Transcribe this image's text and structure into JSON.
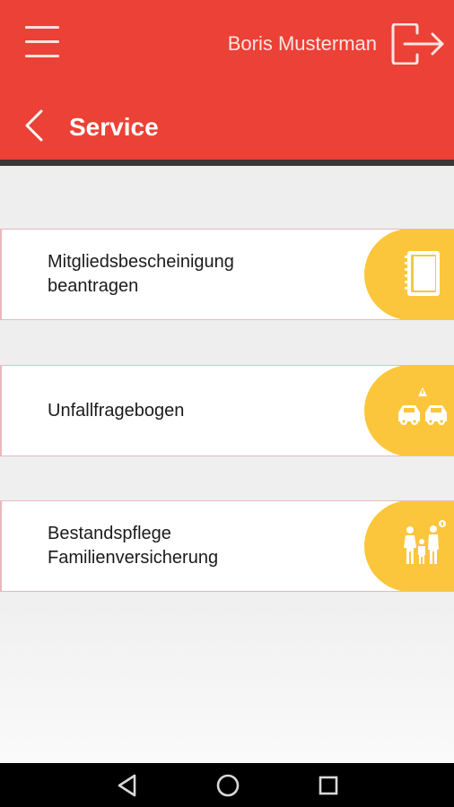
{
  "header": {
    "user_name": "Boris Musterman",
    "title": "Service",
    "icons": {
      "menu": "hamburger-menu-icon",
      "logout": "logout-icon",
      "back": "back-chevron-icon"
    }
  },
  "services": [
    {
      "label": "Mitgliedsbescheinigung\nbeantragen",
      "icon": "notebook-icon"
    },
    {
      "label": "Unfallfragebogen",
      "icon": "car-accident-icon"
    },
    {
      "label": "Bestandspflege\nFamilienversicherung",
      "icon": "family-icon"
    }
  ],
  "navbar": {
    "icons": [
      "nav-back-icon",
      "nav-home-icon",
      "nav-recents-icon"
    ]
  },
  "colors": {
    "header": "#ec4136",
    "accent": "#fcc63c",
    "card_border": "#e9b7bd",
    "background": "#eeeeee"
  }
}
